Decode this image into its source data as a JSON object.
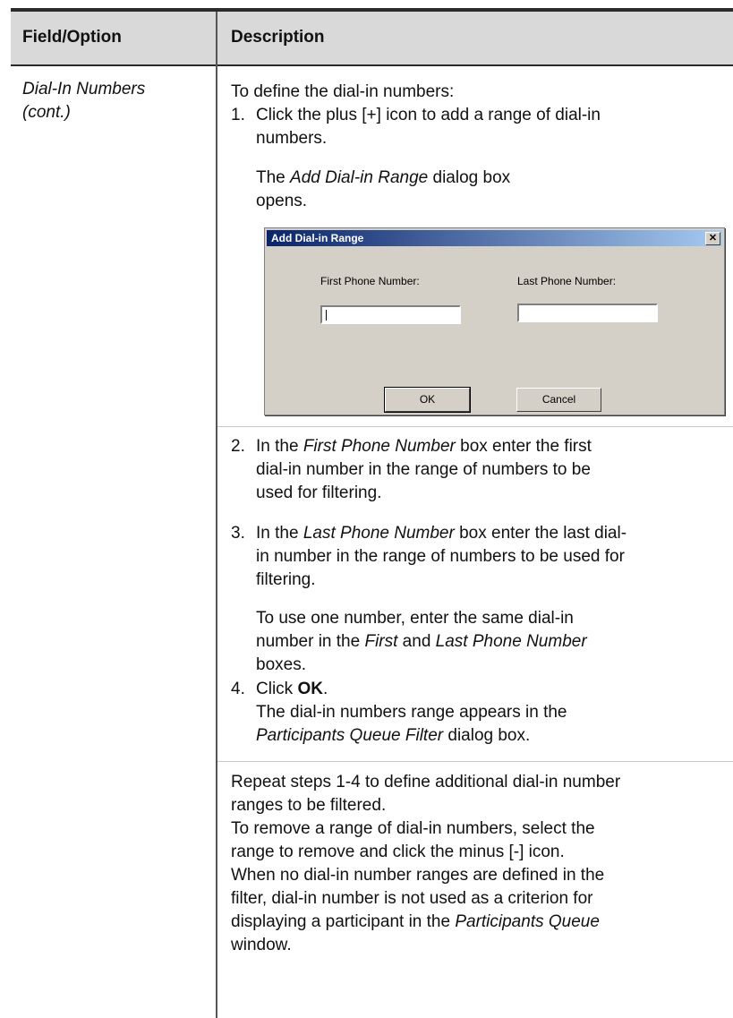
{
  "table": {
    "header": {
      "field": "Field/Option",
      "description": "Description"
    },
    "field_name": [
      "Dial-In Numbers",
      "(cont.)"
    ]
  },
  "intro": "To define the dial-in numbers:",
  "step1": {
    "num": "1.",
    "lines": [
      "Click the plus [+] icon to add a range of dial-in",
      "numbers."
    ],
    "note_pre": "The ",
    "note_em": "Add Dial-in Range",
    "note_post": " dialog box",
    "note_line2": "opens."
  },
  "dialog": {
    "title": "Add Dial-in Range",
    "close_glyph": "✕",
    "first_label": "First Phone Number:",
    "last_label": "Last Phone Number:",
    "first_value": "",
    "last_value": "",
    "ok_label": "OK",
    "cancel_label": "Cancel"
  },
  "step2": {
    "num": "2.",
    "l1_pre": "In the ",
    "l1_em": "First Phone Number",
    "l1_post": " box enter the first",
    "l2": "dial-in number in the range of numbers to be",
    "l3": "used for filtering."
  },
  "step3": {
    "num": "3.",
    "l1_pre": "In the ",
    "l1_em": "Last Phone Number",
    "l1_post": " box enter the last dial-",
    "l2": "in number in the range of numbers to be used for",
    "l3": "filtering.",
    "n1": "To use one number, enter the same dial-in",
    "n2_pre": "number in the ",
    "n2_em1": "First",
    "n2_mid": " and ",
    "n2_em2": "Last Phone Number",
    "n3": "boxes."
  },
  "step4": {
    "num": "4.",
    "l1_pre": "Click ",
    "l1_bold": "OK",
    "l1_post": ".",
    "l2": "The dial-in numbers range appears in the",
    "l3_em": "Participants Queue Filter",
    "l3_post": " dialog box."
  },
  "footer": {
    "p1": "Repeat steps 1-4 to define additional dial-in number",
    "p2": "ranges to be filtered.",
    "p3": "To remove a range of dial-in numbers, select the",
    "p4": "range to remove and click the minus [-] icon.",
    "p5": "When no dial-in number ranges are defined in the",
    "p6": "filter, dial-in number is not used as a criterion for",
    "p7_pre": "displaying a participant in the ",
    "p7_em": "Participants Queue",
    "p8": "window."
  }
}
